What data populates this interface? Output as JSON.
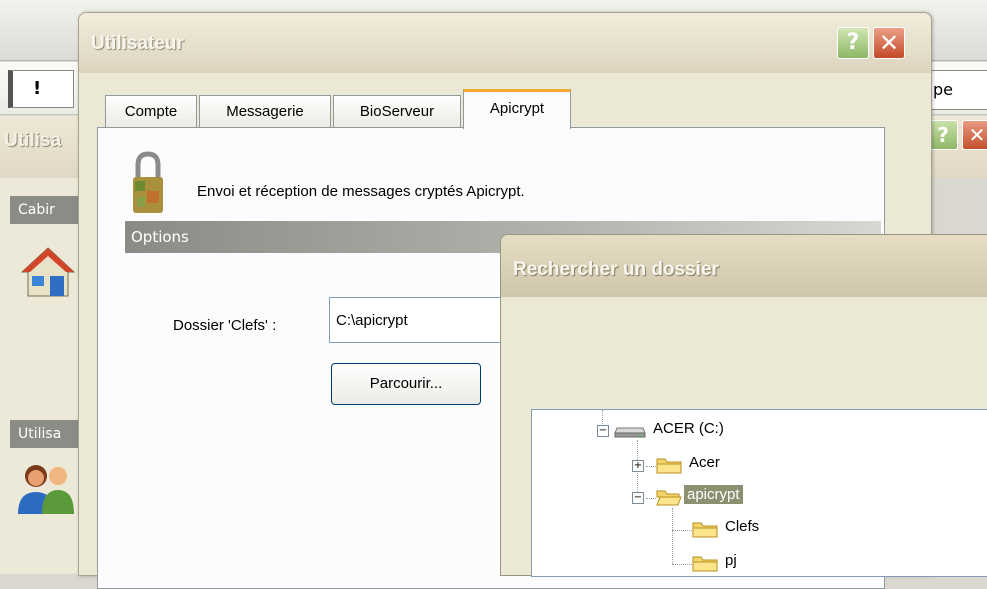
{
  "background_app": {
    "toolbar_button_left": "!",
    "toolbar_button_right_partial": "pe",
    "window_title_partial": "Utilisa",
    "help_glyph": "?",
    "close_glyph": "✕",
    "section_cabinet_partial": "Cabir",
    "section_users_partial": "Utilisa",
    "icons": [
      "house-icon",
      "users-icon"
    ]
  },
  "dialog": {
    "title": "Utilisateur",
    "help_glyph": "?",
    "close_glyph": "✕",
    "tabs": [
      {
        "label": "Compte",
        "active": false
      },
      {
        "label": "Messagerie",
        "active": false
      },
      {
        "label": "BioServeur",
        "active": false
      },
      {
        "label": "Apicrypt",
        "active": true
      }
    ],
    "description": "Envoi et réception de messages cryptés Apicrypt.",
    "lock_icon": "padlock-icon",
    "options_header": "Options",
    "keys_folder_label": "Dossier 'Clefs' :",
    "keys_folder_value": "C:\\apicrypt",
    "browse_button": "Parcourir..."
  },
  "folder_dialog": {
    "title": "Rechercher un dossier",
    "tree": {
      "drive": {
        "label": "ACER (C:)",
        "expanded": true,
        "icon": "drive-icon"
      },
      "items": [
        {
          "label": "Acer",
          "expanded": false,
          "selected": false
        },
        {
          "label": "apicrypt",
          "expanded": true,
          "selected": true,
          "children": [
            {
              "label": "Clefs"
            },
            {
              "label": "pj"
            }
          ]
        }
      ]
    }
  },
  "colors": {
    "active_tab_accent": "#f5a732",
    "help_button": "#8cb866",
    "close_button": "#c34a27",
    "selection": "#8c9070"
  }
}
